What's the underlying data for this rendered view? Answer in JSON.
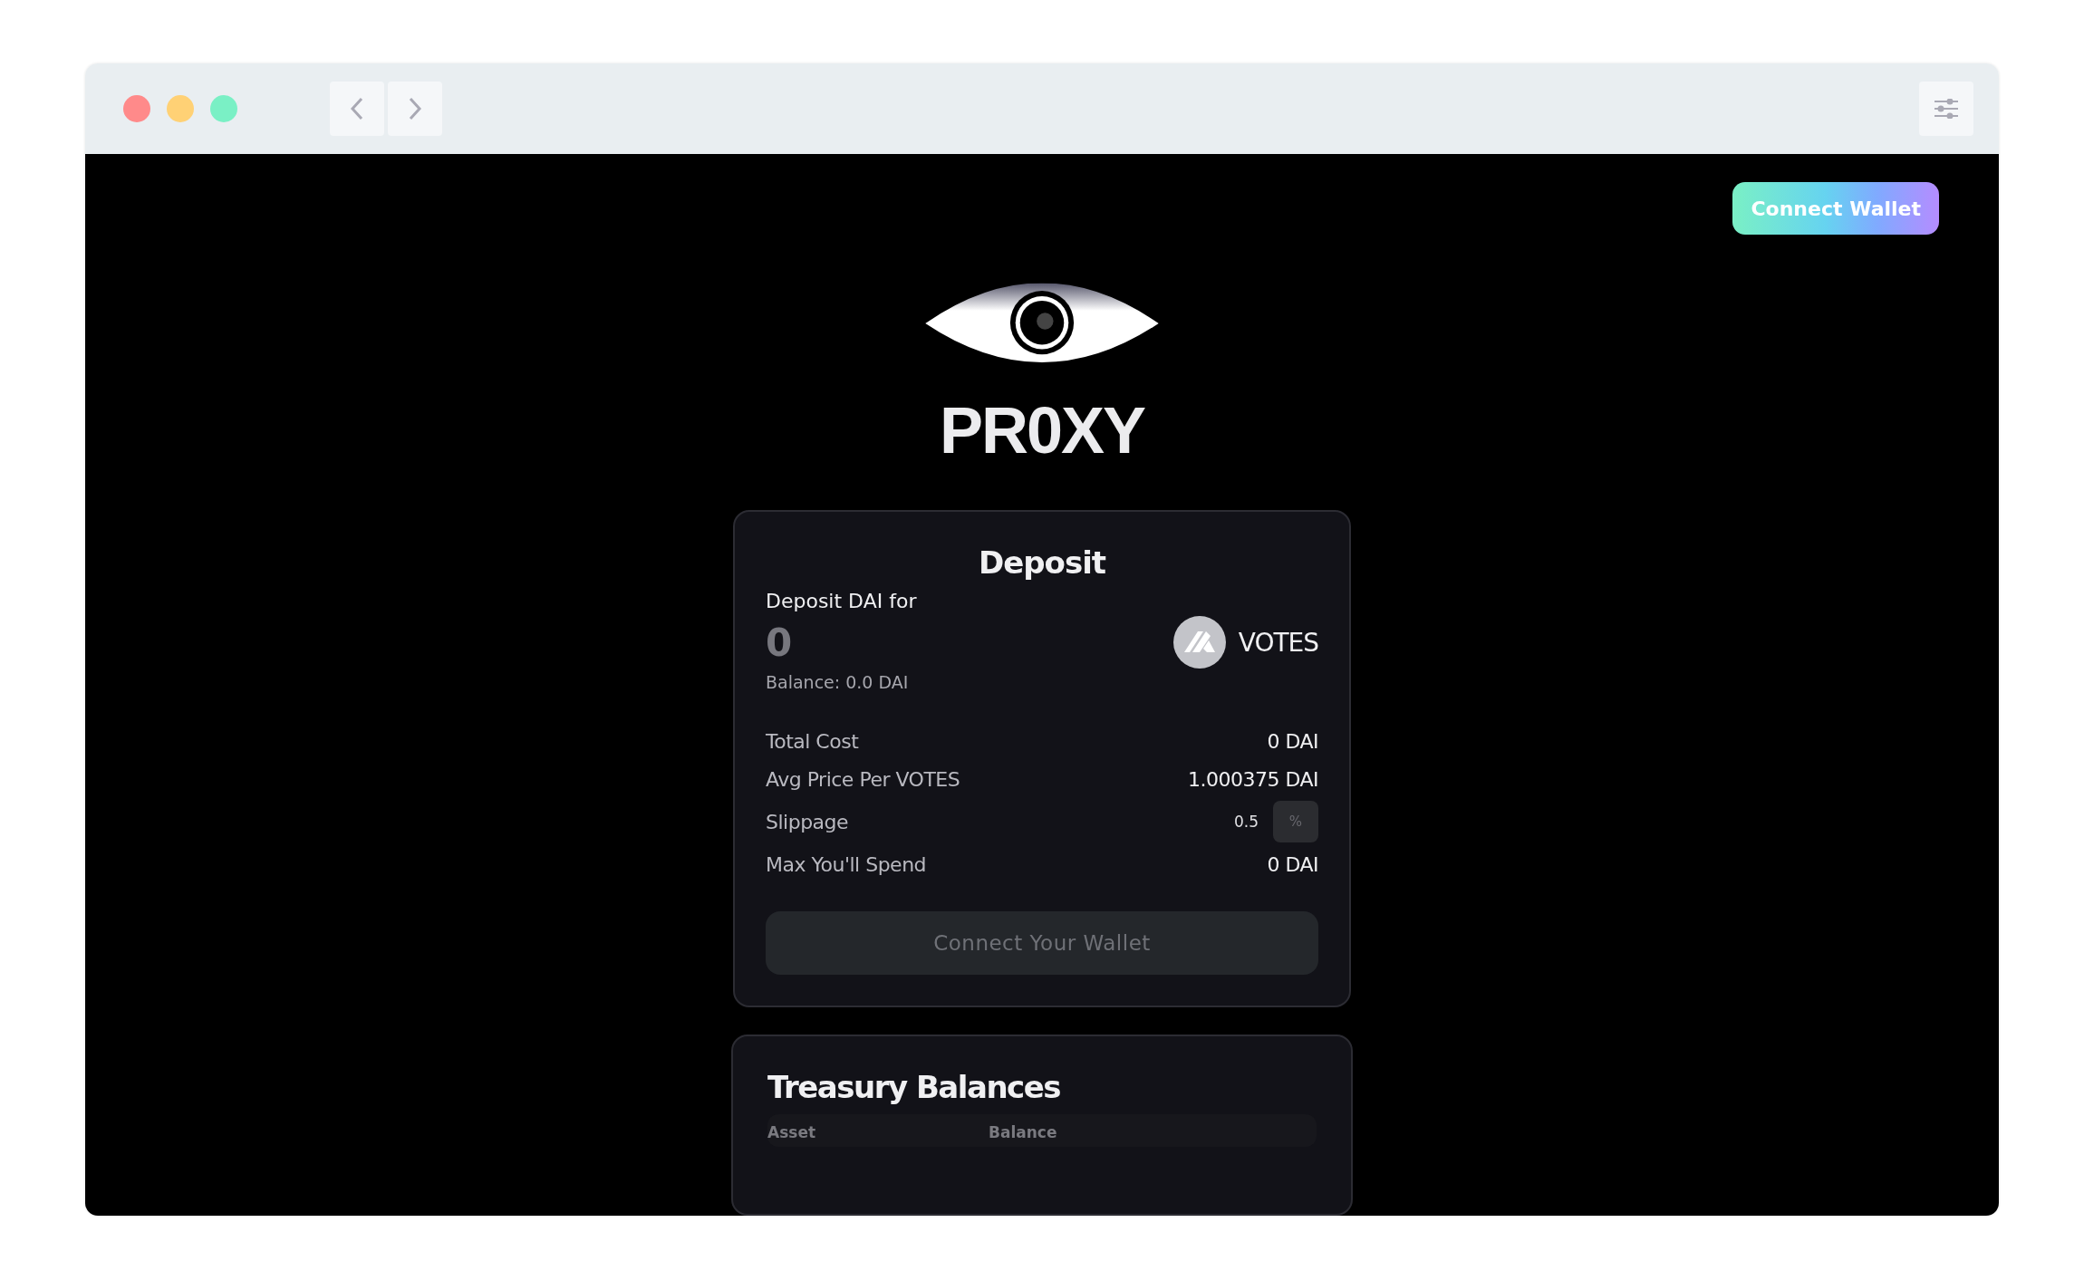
{
  "window": {
    "controls": [
      {
        "color": "#ff8a8a"
      },
      {
        "color": "#ffd175"
      },
      {
        "color": "#7af0c5"
      }
    ]
  },
  "header": {
    "connect_button": "Connect Wallet"
  },
  "logo": {
    "title": "PR0XY"
  },
  "deposit": {
    "title": "Deposit",
    "input_label": "Deposit DAI for",
    "amount_placeholder": "0",
    "balance": "Balance: 0.0 DAI",
    "token": "VOTES",
    "rows": [
      {
        "kind": "text",
        "label": "Total Cost",
        "value": "0 DAI"
      },
      {
        "kind": "text",
        "label": "Avg Price Per VOTES",
        "value": "1.000375 DAI"
      },
      {
        "kind": "input",
        "label": "Slippage",
        "value": "0.5",
        "unit": "%"
      },
      {
        "kind": "text",
        "label": "Max You'll Spend",
        "value": "0 DAI"
      }
    ],
    "button": {
      "label": "Connect Your Wallet",
      "disabled": true
    }
  },
  "treasury": {
    "title": "Treasury Balances",
    "columns": [
      "Asset",
      "Balance"
    ]
  }
}
